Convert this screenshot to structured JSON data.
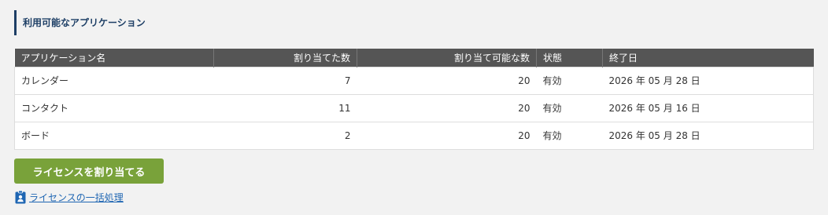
{
  "section": {
    "title": "利用可能なアプリケーション"
  },
  "table": {
    "headers": {
      "name": "アプリケーション名",
      "assigned": "割り当てた数",
      "assignable": "割り当て可能な数",
      "status": "状態",
      "end_date": "終了日"
    },
    "rows": [
      {
        "name": "カレンダー",
        "assigned": "7",
        "assignable": "20",
        "status": "有効",
        "end_date": "2026 年 05 月 28 日"
      },
      {
        "name": "コンタクト",
        "assigned": "11",
        "assignable": "20",
        "status": "有効",
        "end_date": "2026 年 05 月 16 日"
      },
      {
        "name": "ボード",
        "assigned": "2",
        "assignable": "20",
        "status": "有効",
        "end_date": "2026 年 05 月 28 日"
      }
    ]
  },
  "actions": {
    "assign_label": "ライセンスを割り当てる",
    "bulk_label": "ライセンスの一括処理",
    "bulk_icon": "id-badge-icon"
  },
  "colors": {
    "accent_bar": "#1e3f66",
    "header_bg": "#555555",
    "button_green": "#79a23a",
    "link_blue": "#1f66b3"
  }
}
